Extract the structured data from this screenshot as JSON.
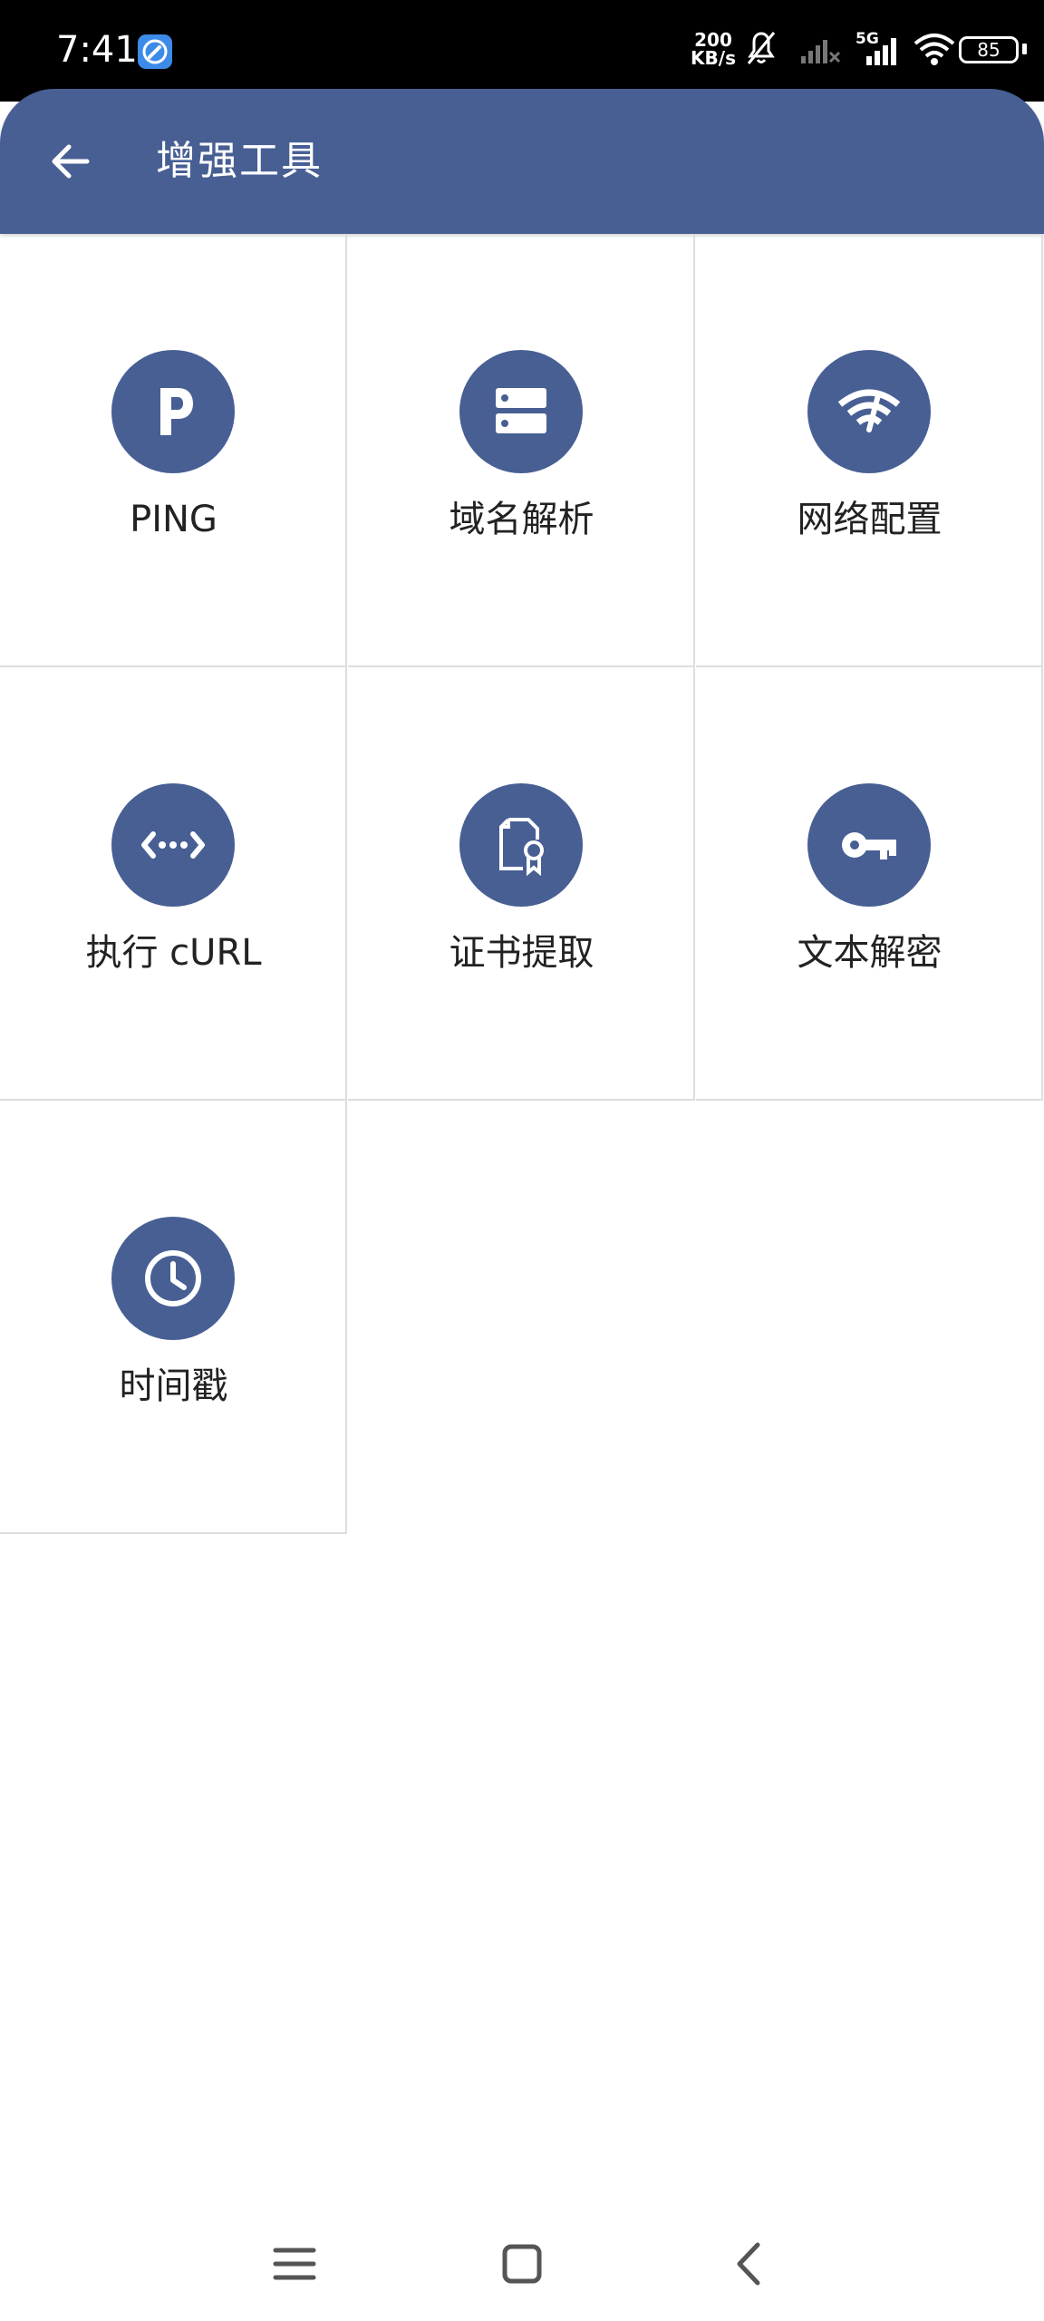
{
  "status_bar": {
    "time": "7:41",
    "net_speed_value": "200",
    "net_speed_unit": "KB/s",
    "network_type": "5G",
    "battery": "85"
  },
  "app_bar": {
    "title": "增强工具",
    "back_icon": "arrow-left-icon"
  },
  "tools": [
    {
      "label": "PING",
      "icon": "ping-p-icon"
    },
    {
      "label": "域名解析",
      "icon": "dns-server-icon"
    },
    {
      "label": "网络配置",
      "icon": "wifi-config-icon"
    },
    {
      "label": "执行 cURL",
      "icon": "code-arrows-icon"
    },
    {
      "label": "证书提取",
      "icon": "certificate-icon"
    },
    {
      "label": "文本解密",
      "icon": "key-icon"
    },
    {
      "label": "时间戳",
      "icon": "clock-icon"
    }
  ],
  "nav_bar": {
    "items": [
      "menu-icon",
      "home-icon",
      "back-icon"
    ]
  },
  "colors": {
    "primary": "#485f94",
    "status_bar": "#000000",
    "divider": "#dedede",
    "label_text": "#222222"
  }
}
